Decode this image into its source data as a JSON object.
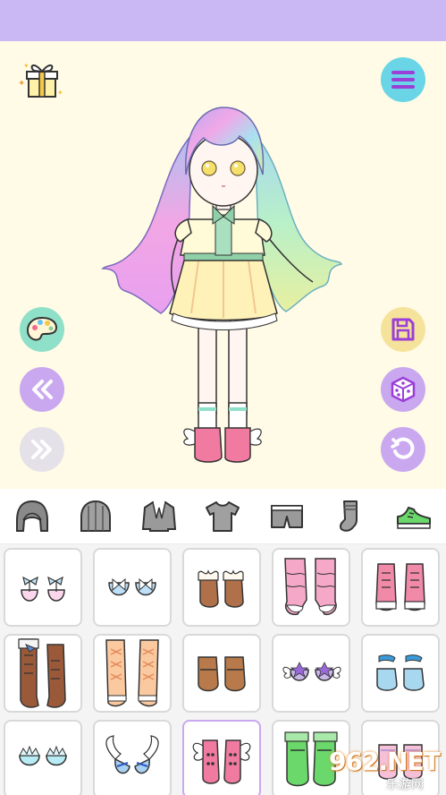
{
  "colors": {
    "topbar": "#c9b8f3",
    "stage": "#fffbe6",
    "menu": "#69d5e6",
    "palette": "#8fe0c8",
    "save": "#f5e39b",
    "purple": "#c9a8f0",
    "next_disabled": "#e4e1e8"
  },
  "stage_buttons": {
    "gift": "gift-icon",
    "menu": "menu-icon",
    "palette": "palette-icon",
    "save": "save-icon",
    "previous": "double-chevron-left-icon",
    "random": "dice-icon",
    "next": "double-chevron-right-icon",
    "undo": "undo-icon"
  },
  "category_tabs": [
    {
      "icon": "hair-icon"
    },
    {
      "icon": "hat-icon"
    },
    {
      "icon": "jacket-icon"
    },
    {
      "icon": "shirt-icon"
    },
    {
      "icon": "shorts-icon"
    },
    {
      "icon": "sock-icon"
    },
    {
      "icon": "shoe-icon",
      "active": true
    }
  ],
  "items": [
    {
      "icon": "pink-bow-flats-icon"
    },
    {
      "icon": "blue-bow-flats-icon"
    },
    {
      "icon": "brown-fur-boots-icon"
    },
    {
      "icon": "pink-slouch-boots-icon"
    },
    {
      "icon": "pink-high-top-sneakers-icon"
    },
    {
      "icon": "brown-knee-boots-icon"
    },
    {
      "icon": "peach-lace-boots-icon"
    },
    {
      "icon": "brown-loafers-icon"
    },
    {
      "icon": "lilac-winged-shoes-icon"
    },
    {
      "icon": "blue-ankle-boots-icon"
    },
    {
      "icon": "blue-crown-slippers-icon"
    },
    {
      "icon": "blue-winged-heels-icon"
    },
    {
      "icon": "pink-winged-sneakers-icon",
      "selected": true
    },
    {
      "icon": "green-boots-icon"
    },
    {
      "icon": "pink-shoes-icon"
    }
  ],
  "watermark": {
    "main": "962.NET",
    "sub": "乐游网"
  }
}
